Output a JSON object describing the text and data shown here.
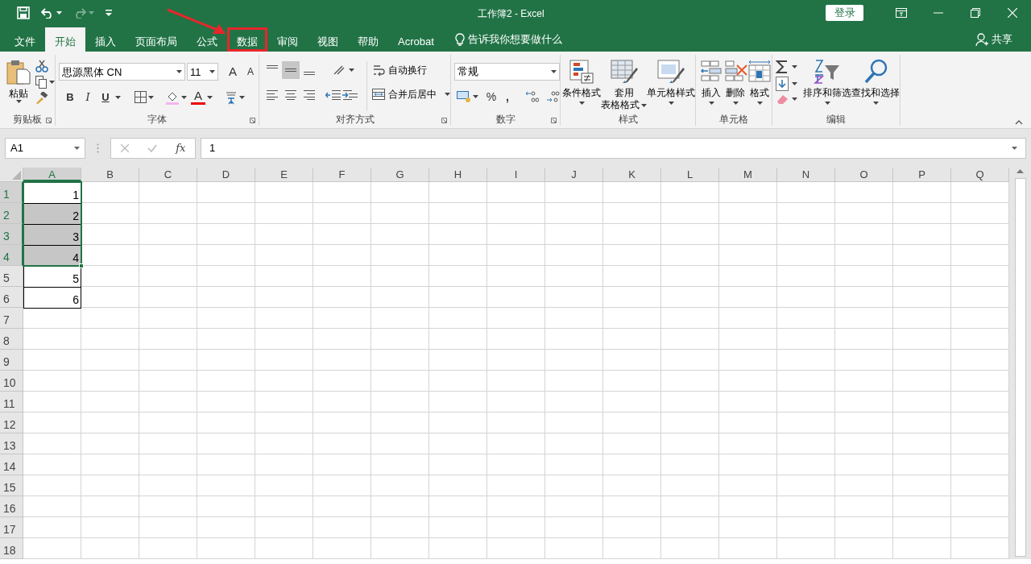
{
  "window": {
    "title": "工作簿2 - Excel",
    "sign_in": "登录"
  },
  "tabs": [
    {
      "label": "文件",
      "selected": false,
      "highlighted": false
    },
    {
      "label": "开始",
      "selected": true,
      "highlighted": false
    },
    {
      "label": "插入",
      "selected": false,
      "highlighted": false
    },
    {
      "label": "页面布局",
      "selected": false,
      "highlighted": false
    },
    {
      "label": "公式",
      "selected": false,
      "highlighted": false
    },
    {
      "label": "数据",
      "selected": false,
      "highlighted": true
    },
    {
      "label": "审阅",
      "selected": false,
      "highlighted": false
    },
    {
      "label": "视图",
      "selected": false,
      "highlighted": false
    },
    {
      "label": "帮助",
      "selected": false,
      "highlighted": false
    },
    {
      "label": "Acrobat",
      "selected": false,
      "highlighted": false
    }
  ],
  "tell_me": "告诉我你想要做什么",
  "share": "共享",
  "ribbon": {
    "clipboard": {
      "label": "剪贴板",
      "paste": "粘贴"
    },
    "font": {
      "label": "字体",
      "font_name": "思源黑体 CN",
      "font_size": "11",
      "grow": "A",
      "shrink": "A",
      "bold": "B",
      "italic": "I",
      "underline": "U",
      "font_color": "A"
    },
    "alignment": {
      "label": "对齐方式",
      "wrap": "自动换行",
      "merge": "合并后居中"
    },
    "number": {
      "label": "数字",
      "format": "常规",
      "percent": "%",
      "comma": ","
    },
    "styles": {
      "label": "样式",
      "buttons": [
        {
          "lines": [
            "条件格式"
          ]
        },
        {
          "lines": [
            "套用",
            "表格格式"
          ]
        },
        {
          "lines": [
            "单元格样式"
          ]
        }
      ]
    },
    "cells": {
      "label": "单元格",
      "buttons": [
        {
          "lines": [
            "插入"
          ]
        },
        {
          "lines": [
            "删除"
          ]
        },
        {
          "lines": [
            "格式"
          ]
        }
      ]
    },
    "editing": {
      "label": "编辑",
      "buttons": [
        {
          "lines": [
            "排序和筛选"
          ]
        },
        {
          "lines": [
            "查找和选择"
          ]
        }
      ]
    }
  },
  "formula_bar": {
    "name_box": "A1",
    "function_label": "fx",
    "formula": "1"
  },
  "columns": [
    {
      "label": "A",
      "selected": true
    },
    {
      "label": "B",
      "selected": false
    },
    {
      "label": "C",
      "selected": false
    },
    {
      "label": "D",
      "selected": false
    },
    {
      "label": "E",
      "selected": false
    },
    {
      "label": "F",
      "selected": false
    },
    {
      "label": "G",
      "selected": false
    },
    {
      "label": "H",
      "selected": false
    },
    {
      "label": "I",
      "selected": false
    },
    {
      "label": "J",
      "selected": false
    },
    {
      "label": "K",
      "selected": false
    },
    {
      "label": "L",
      "selected": false
    },
    {
      "label": "M",
      "selected": false
    },
    {
      "label": "N",
      "selected": false
    },
    {
      "label": "O",
      "selected": false
    },
    {
      "label": "P",
      "selected": false
    },
    {
      "label": "Q",
      "selected": false
    }
  ],
  "rows": [
    {
      "label": "1",
      "selected": true,
      "bordered": true,
      "value": "1"
    },
    {
      "label": "2",
      "selected": true,
      "bordered": true,
      "value": "2"
    },
    {
      "label": "3",
      "selected": true,
      "bordered": true,
      "value": "3"
    },
    {
      "label": "4",
      "selected": true,
      "bordered": true,
      "value": "4"
    },
    {
      "label": "5",
      "selected": false,
      "bordered": true,
      "value": "5"
    },
    {
      "label": "6",
      "selected": false,
      "bordered": true,
      "value": "6"
    },
    {
      "label": "7",
      "selected": false,
      "bordered": false
    },
    {
      "label": "8",
      "selected": false,
      "bordered": false
    },
    {
      "label": "9",
      "selected": false,
      "bordered": false
    },
    {
      "label": "10",
      "selected": false,
      "bordered": false
    },
    {
      "label": "11",
      "selected": false,
      "bordered": false
    },
    {
      "label": "12",
      "selected": false,
      "bordered": false
    },
    {
      "label": "13",
      "selected": false,
      "bordered": false
    },
    {
      "label": "14",
      "selected": false,
      "bordered": false
    },
    {
      "label": "15",
      "selected": false,
      "bordered": false
    },
    {
      "label": "16",
      "selected": false,
      "bordered": false
    },
    {
      "label": "17",
      "selected": false,
      "bordered": false
    },
    {
      "label": "18",
      "selected": false,
      "bordered": false
    }
  ]
}
